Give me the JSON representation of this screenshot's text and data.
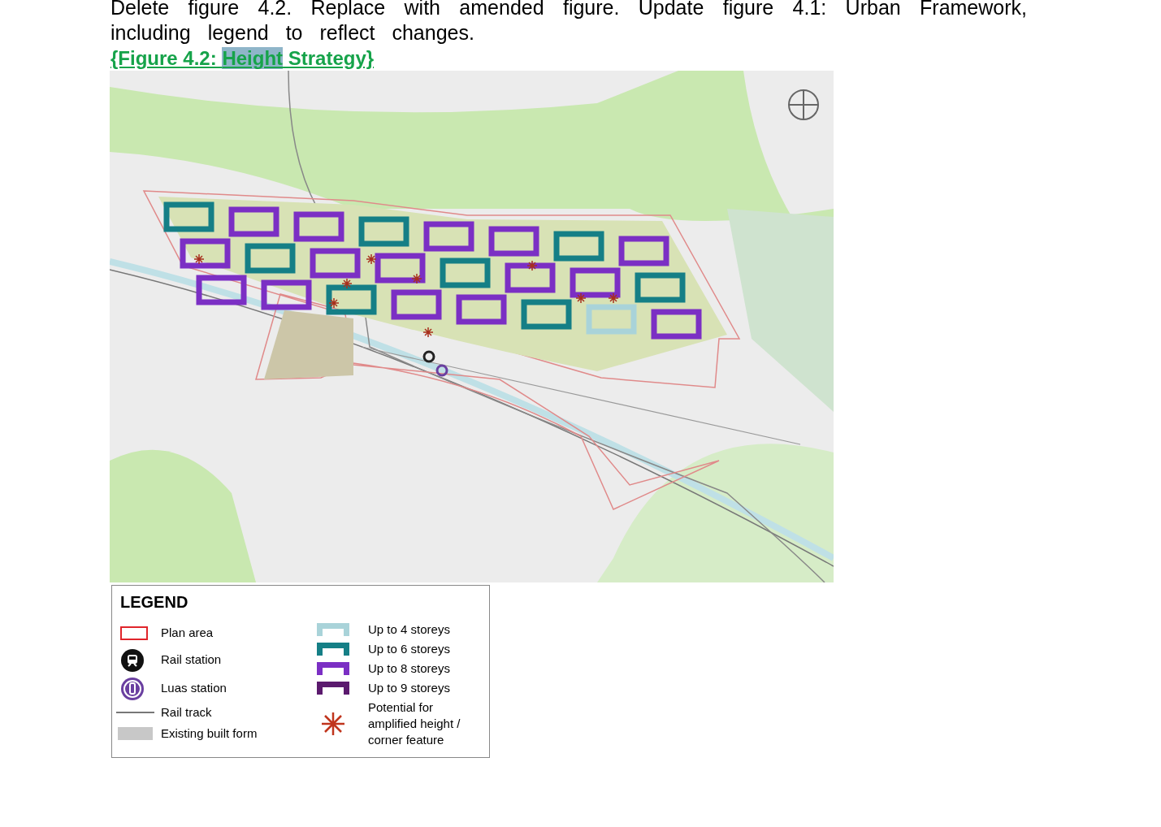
{
  "instruction": "Delete figure 4.2. Replace with amended figure. Update figure 4.1: Urban Framework, including legend to reflect changes.",
  "figure_caption": [
    {
      "text": "{Figure 4.2: ",
      "selected": false
    },
    {
      "text": "Height",
      "selected": true
    },
    {
      "text": " Strategy}",
      "selected": false
    }
  ],
  "legend": {
    "title": "LEGEND",
    "left_items": [
      {
        "kind": "plan-area",
        "label": "Plan area"
      },
      {
        "kind": "rail-station",
        "label": "Rail station"
      },
      {
        "kind": "luas-station",
        "label": "Luas station"
      },
      {
        "kind": "rail-track",
        "label": "Rail track"
      },
      {
        "kind": "built-form",
        "label": "Existing built form"
      }
    ],
    "right_items": [
      {
        "kind": "storeys",
        "label": "Up to 4 storeys",
        "color": "#a9d3d9"
      },
      {
        "kind": "storeys",
        "label": "Up to 6 storeys",
        "color": "#157f86"
      },
      {
        "kind": "storeys",
        "label": "Up to 8 storeys",
        "color": "#7b2fc4"
      },
      {
        "kind": "storeys",
        "label": "Up to 9 storeys",
        "color": "#5b1a6e"
      },
      {
        "kind": "star",
        "label": "Potential for amplified height / corner feature"
      }
    ]
  }
}
